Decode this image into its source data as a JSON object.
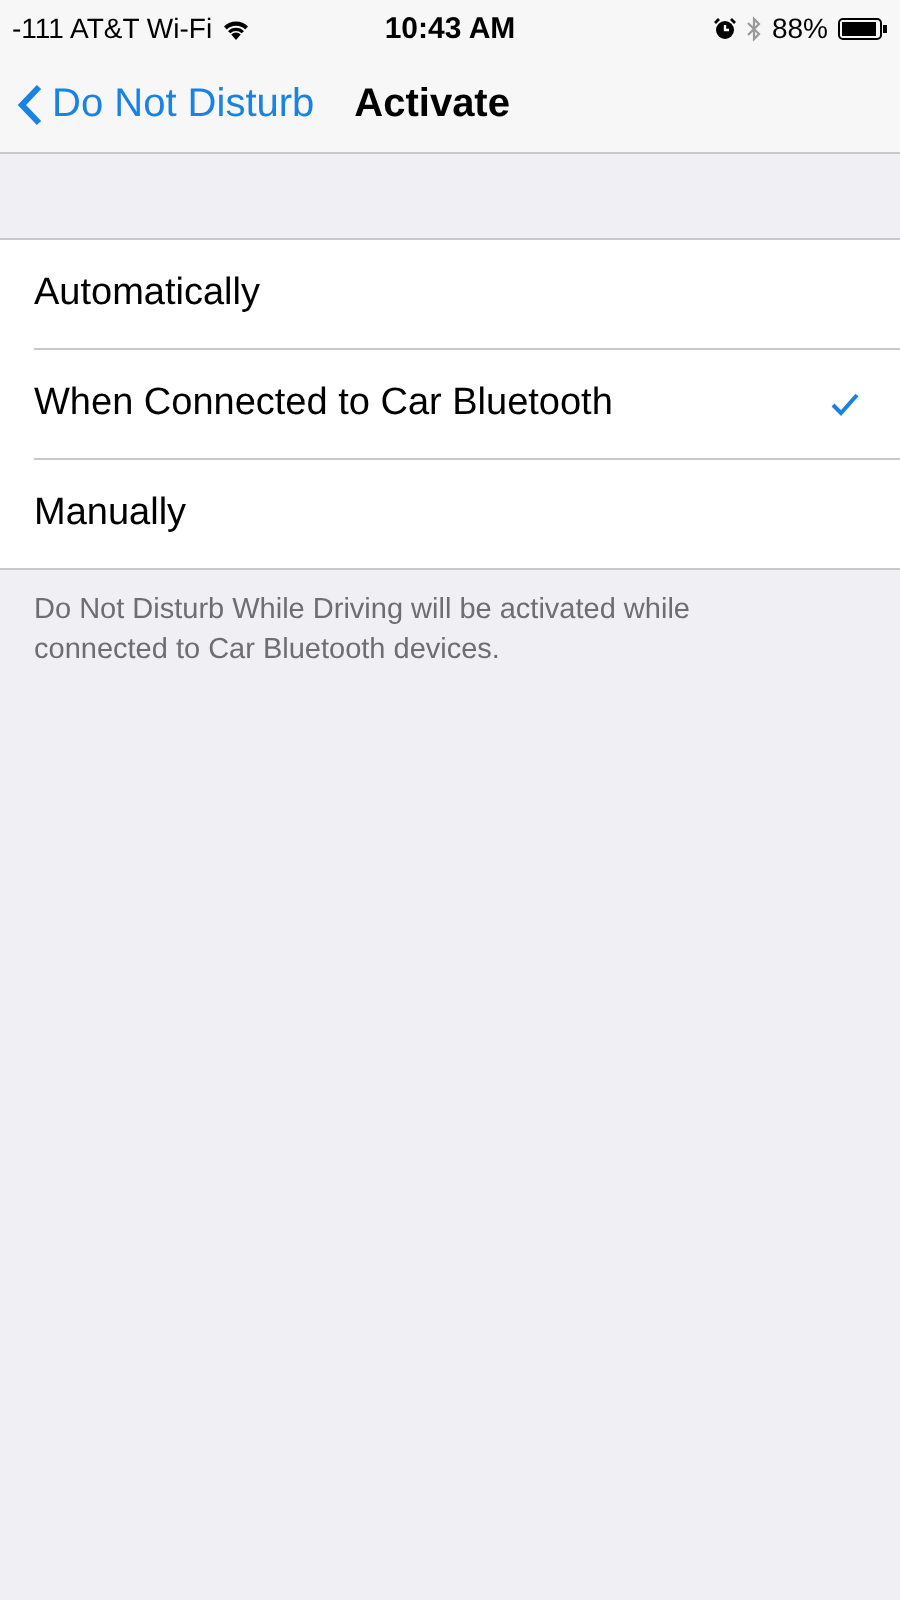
{
  "status_bar": {
    "carrier": "-111 AT&T Wi-Fi",
    "time": "10:43 AM",
    "battery": "88%"
  },
  "nav": {
    "back": "Do Not Disturb",
    "title": "Activate"
  },
  "options": [
    {
      "label": "Automatically",
      "selected": false
    },
    {
      "label": "When Connected to Car Bluetooth",
      "selected": true
    },
    {
      "label": "Manually",
      "selected": false
    }
  ],
  "footer": "Do Not Disturb While Driving will be activated while connected to Car Bluetooth devices."
}
